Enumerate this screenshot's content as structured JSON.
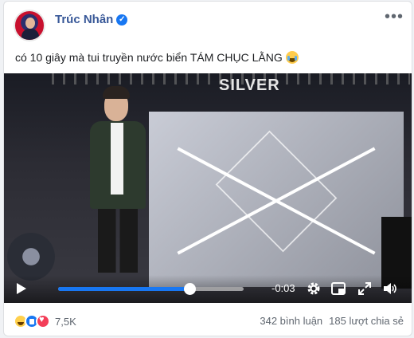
{
  "post": {
    "author": "Trúc Nhân",
    "verified_icon": "verified-badge-icon",
    "more_icon": "more-options-icon",
    "caption": "có 10 giây mà tui truyền nước biển TÁM CHỤC LẰNG",
    "caption_emoji": "crying-face-emoji"
  },
  "video": {
    "stage_sign": "SILVER",
    "time_remaining": "-0:03",
    "progress_fraction": 0.71,
    "controls": [
      "play-icon",
      "settings-icon",
      "picture-in-picture-icon",
      "fullscreen-icon",
      "volume-icon"
    ]
  },
  "footer": {
    "reactions": [
      "haha",
      "like",
      "love"
    ],
    "reaction_count": "7,5K",
    "comments": "342 bình luận",
    "shares": "185 lượt chia sẻ"
  },
  "colors": {
    "author_link": "#385898",
    "progress": "#1877f2"
  }
}
